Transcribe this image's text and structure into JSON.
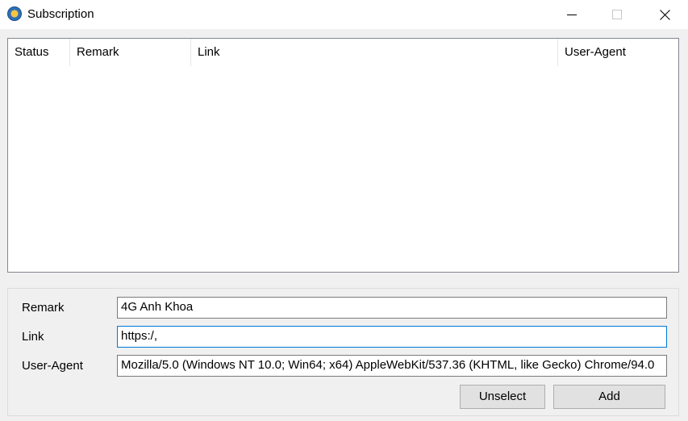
{
  "window": {
    "title": "Subscription",
    "icon": "app-globe-icon"
  },
  "list": {
    "columns": [
      "Status",
      "Remark",
      "Link",
      "User-Agent"
    ],
    "rows": []
  },
  "form": {
    "remark_label": "Remark",
    "remark_value": "4G Anh Khoa",
    "link_label": "Link",
    "link_value": "https:/,",
    "ua_label": "User-Agent",
    "ua_value": "Mozilla/5.0 (Windows NT 10.0; Win64; x64) AppleWebKit/537.36 (KHTML, like Gecko) Chrome/94.0"
  },
  "buttons": {
    "unselect": "Unselect",
    "add": "Add"
  },
  "colors": {
    "focus_border": "#0078d7",
    "background": "#f0f0f0"
  }
}
